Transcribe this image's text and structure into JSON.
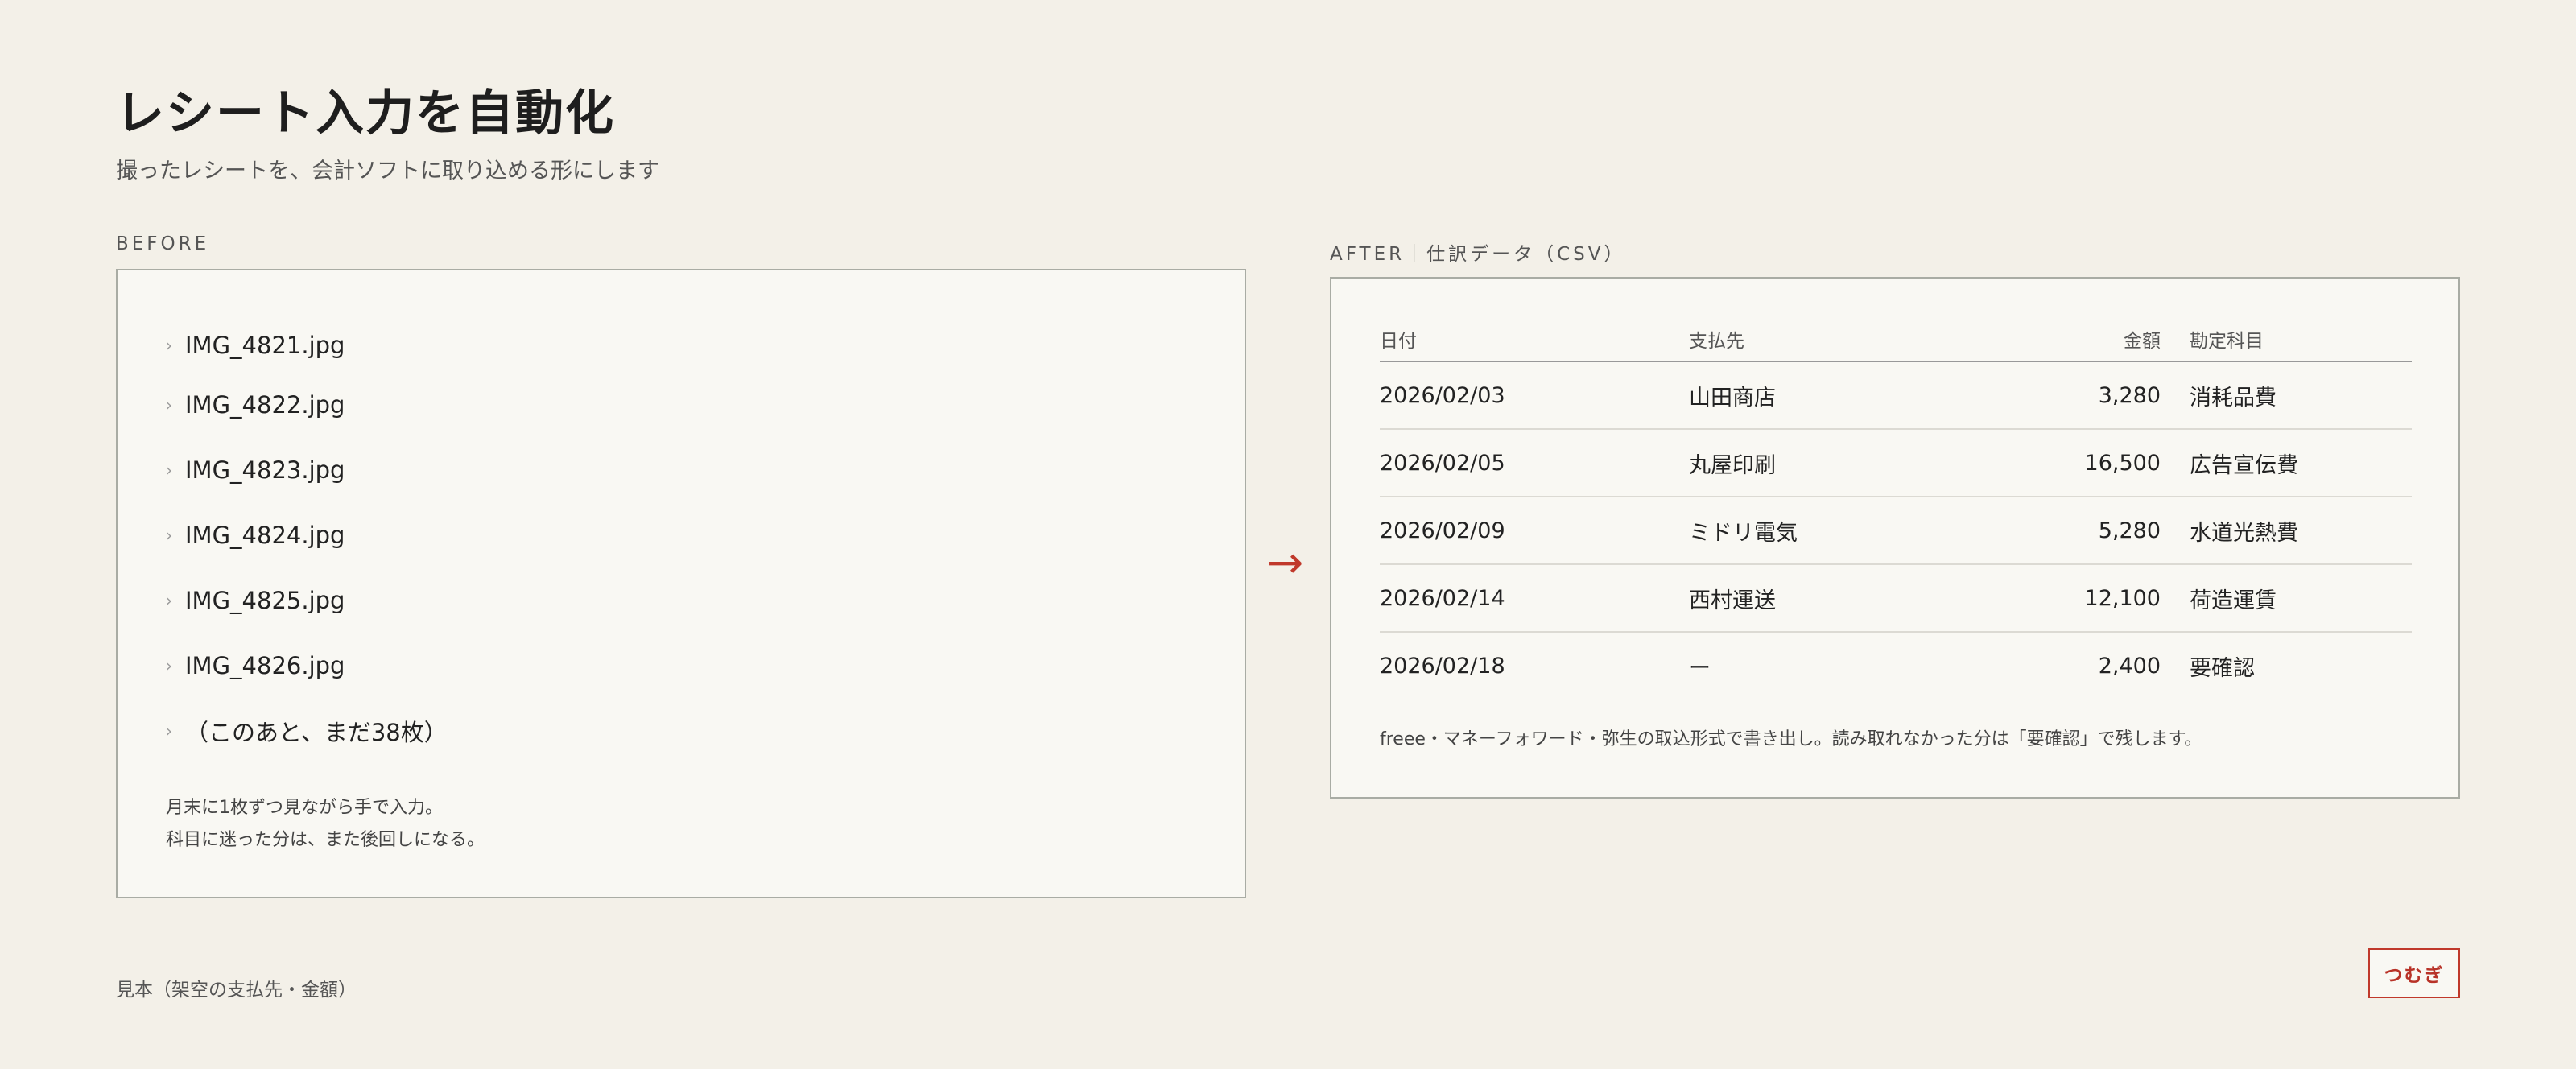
{
  "header": {
    "title": "レシート入力を自動化",
    "subtitle": "撮ったレシートを、会計ソフトに取り込める形にします"
  },
  "before": {
    "label": "BEFORE",
    "files": [
      "IMG_4821.jpg",
      "IMG_4822.jpg",
      "IMG_4823.jpg",
      "IMG_4824.jpg",
      "IMG_4825.jpg",
      "IMG_4826.jpg",
      "（このあと、まだ38枚）"
    ],
    "note_lines": [
      "月末に1枚ずつ見ながら手で入力。",
      "科目に迷った分は、また後回しになる。"
    ]
  },
  "arrow": "→",
  "after": {
    "label": "AFTER｜仕訳データ（CSV）",
    "columns": [
      "日付",
      "支払先",
      "金額",
      "勘定科目"
    ],
    "rows": [
      [
        "2026/02/03",
        "山田商店",
        "3,280",
        "消耗品費"
      ],
      [
        "2026/02/05",
        "丸屋印刷",
        "16,500",
        "広告宣伝費"
      ],
      [
        "2026/02/09",
        "ミドリ電気",
        "5,280",
        "水道光熱費"
      ],
      [
        "2026/02/14",
        "西村運送",
        "12,100",
        "荷造運賃"
      ],
      [
        "2026/02/18",
        "ー",
        "2,400",
        "要確認"
      ]
    ],
    "note": "freee・マネーフォワード・弥生の取込形式で書き出し。読み取れなかった分は「要確認」で残します。"
  },
  "footer": {
    "note": "見本（架空の支払先・金額）",
    "brand": "つむぎ"
  },
  "colors": {
    "background": "#f3f0e8",
    "panel": "#f9f8f3",
    "accent": "#c0392b"
  }
}
